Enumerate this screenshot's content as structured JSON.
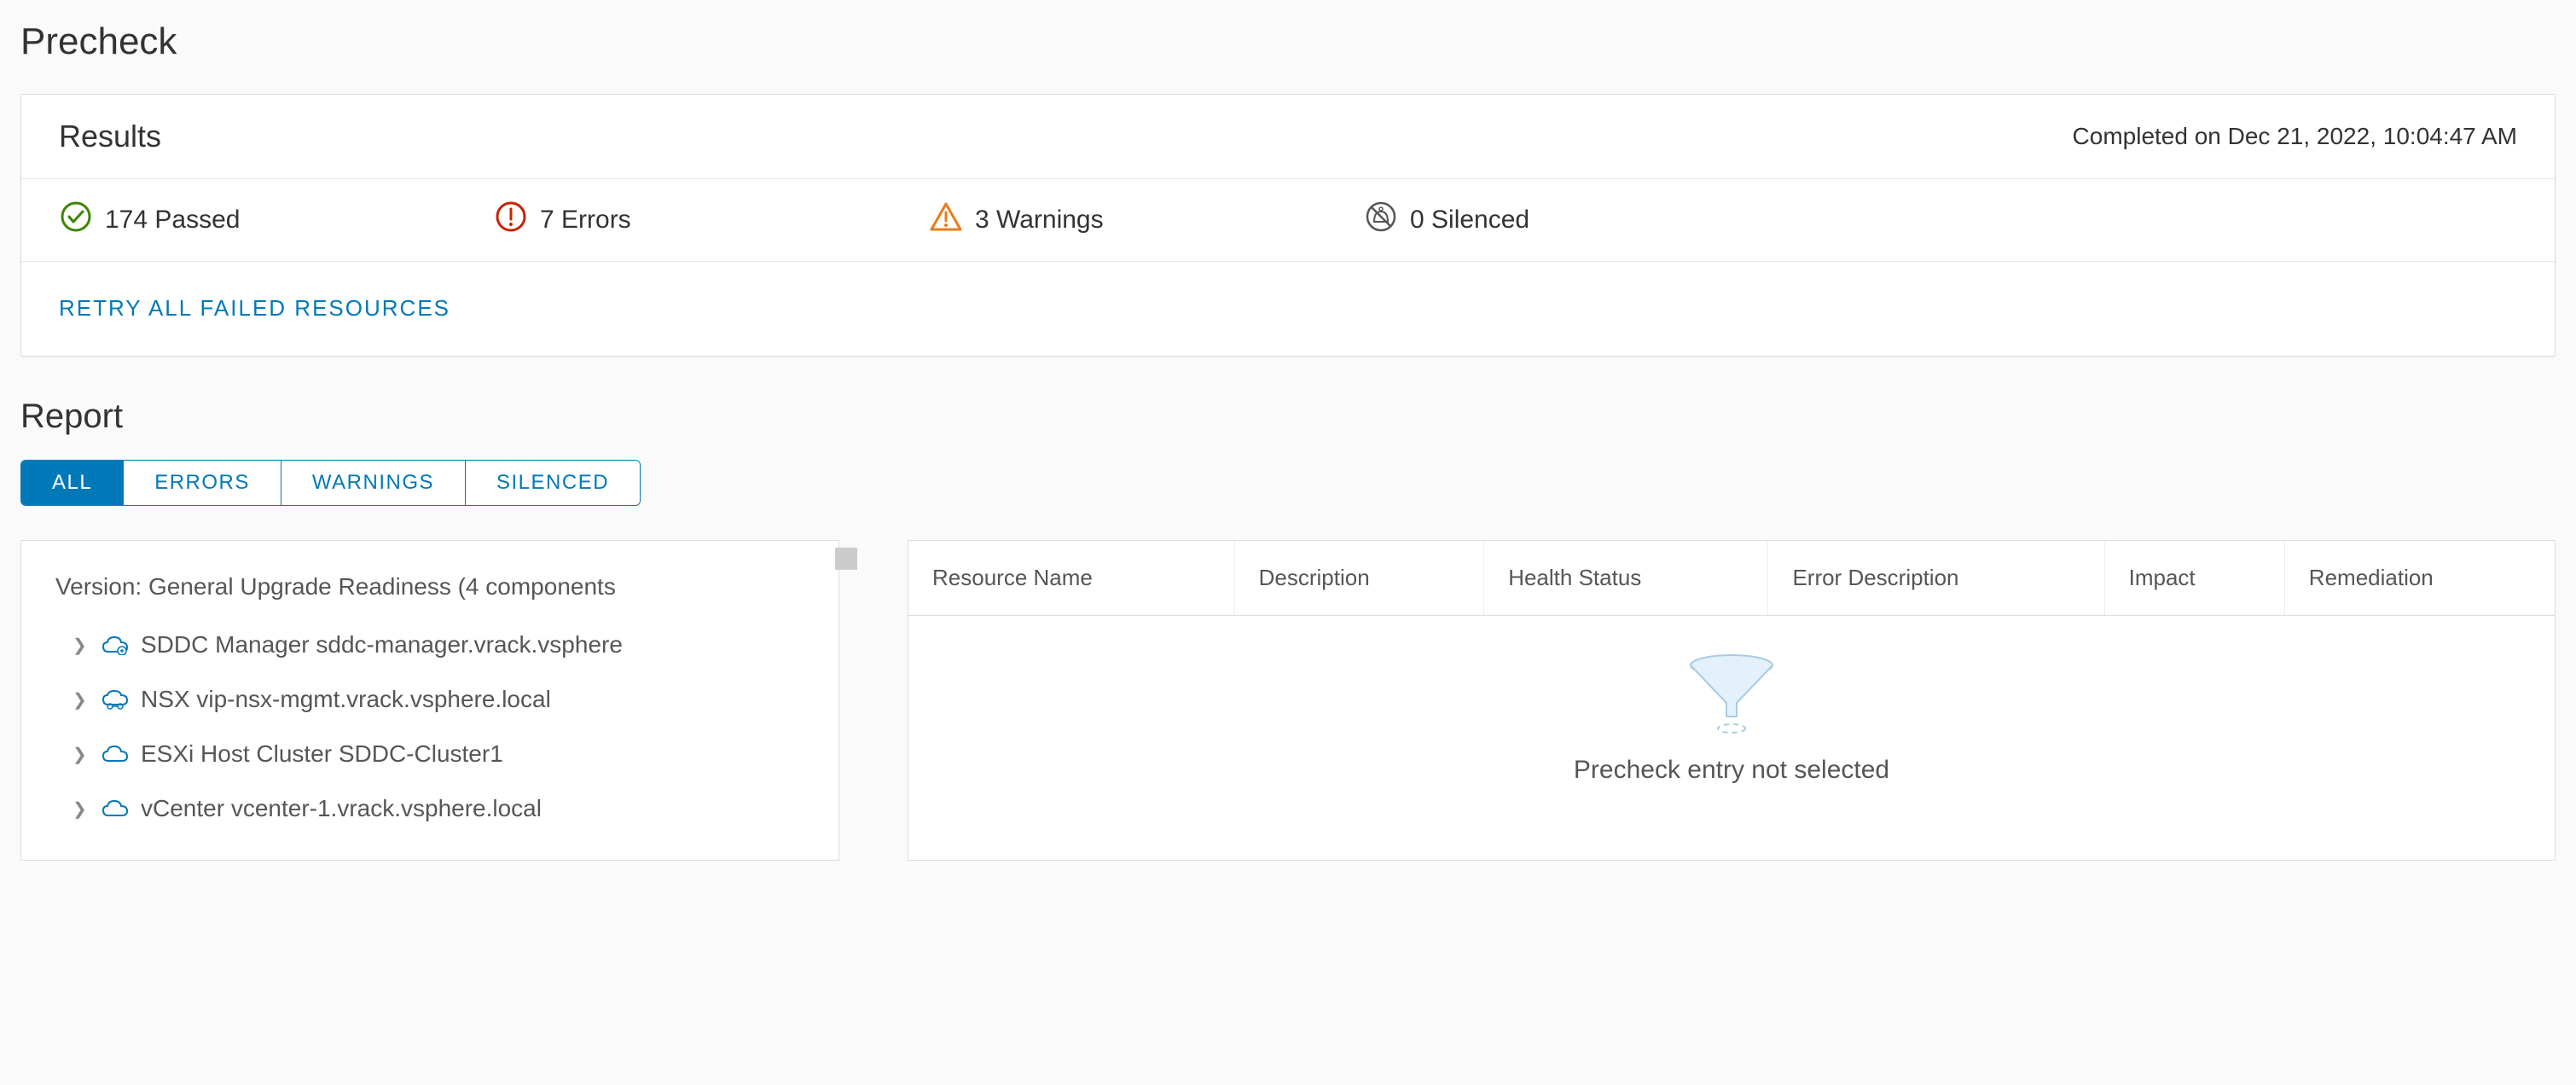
{
  "page_title": "Precheck",
  "results": {
    "title": "Results",
    "timestamp": "Completed on Dec 21, 2022, 10:04:47 AM",
    "passed": "174 Passed",
    "errors": "7 Errors",
    "warnings": "3 Warnings",
    "silenced": "0 Silenced",
    "retry_label": "RETRY ALL FAILED RESOURCES"
  },
  "report": {
    "title": "Report",
    "tabs": {
      "all": "ALL",
      "errors": "ERRORS",
      "warnings": "WARNINGS",
      "silenced": "SILENCED"
    },
    "tree_root": "Version: General Upgrade Readiness (4 components",
    "tree": [
      {
        "label": "SDDC Manager sddc-manager.vrack.vsphere"
      },
      {
        "label": "NSX vip-nsx-mgmt.vrack.vsphere.local"
      },
      {
        "label": "ESXi Host Cluster SDDC-Cluster1"
      },
      {
        "label": "vCenter vcenter-1.vrack.vsphere.local"
      }
    ],
    "columns": {
      "resource": "Resource Name",
      "description": "Description",
      "health": "Health Status",
      "errordesc": "Error Description",
      "impact": "Impact",
      "remediation": "Remediation"
    },
    "empty_text": "Precheck entry not selected"
  }
}
